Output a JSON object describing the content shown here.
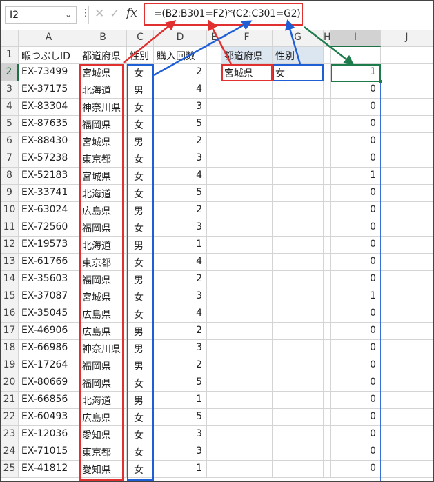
{
  "namebox": {
    "value": "I2",
    "dropdown_icon": "chevron-down-icon"
  },
  "formula_bar": {
    "more_icon": "ellipsis-icon",
    "cancel_icon": "close-icon",
    "enter_icon": "check-icon",
    "fx_label": "fx",
    "formula": "=(B2:B301=F2)*(C2:C301=G2)"
  },
  "columns": [
    "A",
    "B",
    "C",
    "D",
    "E",
    "F",
    "G",
    "H",
    "I",
    "J"
  ],
  "header_row": {
    "a": "暇つぶしID",
    "b": "都道府県",
    "c": "性別",
    "d": "購入回数",
    "f": "都道府県",
    "g": "性別"
  },
  "criteria": {
    "prefecture": "宮城県",
    "gender": "女"
  },
  "rows": [
    {
      "num": "2",
      "id": "EX-73499",
      "pref": "宮城県",
      "gender": "女",
      "count": "2",
      "result": "1"
    },
    {
      "num": "3",
      "id": "EX-37175",
      "pref": "北海道",
      "gender": "男",
      "count": "4",
      "result": "0"
    },
    {
      "num": "4",
      "id": "EX-83304",
      "pref": "神奈川県",
      "gender": "女",
      "count": "3",
      "result": "0"
    },
    {
      "num": "5",
      "id": "EX-87635",
      "pref": "福岡県",
      "gender": "女",
      "count": "5",
      "result": "0"
    },
    {
      "num": "6",
      "id": "EX-88430",
      "pref": "宮城県",
      "gender": "男",
      "count": "2",
      "result": "0"
    },
    {
      "num": "7",
      "id": "EX-57238",
      "pref": "東京都",
      "gender": "女",
      "count": "3",
      "result": "0"
    },
    {
      "num": "8",
      "id": "EX-52183",
      "pref": "宮城県",
      "gender": "女",
      "count": "4",
      "result": "1"
    },
    {
      "num": "9",
      "id": "EX-33741",
      "pref": "北海道",
      "gender": "女",
      "count": "5",
      "result": "0"
    },
    {
      "num": "10",
      "id": "EX-63024",
      "pref": "広島県",
      "gender": "男",
      "count": "2",
      "result": "0"
    },
    {
      "num": "11",
      "id": "EX-72560",
      "pref": "福岡県",
      "gender": "女",
      "count": "3",
      "result": "0"
    },
    {
      "num": "12",
      "id": "EX-19573",
      "pref": "北海道",
      "gender": "男",
      "count": "1",
      "result": "0"
    },
    {
      "num": "13",
      "id": "EX-61766",
      "pref": "東京都",
      "gender": "女",
      "count": "4",
      "result": "0"
    },
    {
      "num": "14",
      "id": "EX-35603",
      "pref": "福岡県",
      "gender": "男",
      "count": "2",
      "result": "0"
    },
    {
      "num": "15",
      "id": "EX-37087",
      "pref": "宮城県",
      "gender": "女",
      "count": "3",
      "result": "1"
    },
    {
      "num": "16",
      "id": "EX-35045",
      "pref": "広島県",
      "gender": "女",
      "count": "4",
      "result": "0"
    },
    {
      "num": "17",
      "id": "EX-46906",
      "pref": "広島県",
      "gender": "男",
      "count": "2",
      "result": "0"
    },
    {
      "num": "18",
      "id": "EX-66986",
      "pref": "神奈川県",
      "gender": "男",
      "count": "3",
      "result": "0"
    },
    {
      "num": "19",
      "id": "EX-17264",
      "pref": "福岡県",
      "gender": "男",
      "count": "2",
      "result": "0"
    },
    {
      "num": "20",
      "id": "EX-80669",
      "pref": "福岡県",
      "gender": "女",
      "count": "5",
      "result": "0"
    },
    {
      "num": "21",
      "id": "EX-66856",
      "pref": "北海道",
      "gender": "男",
      "count": "1",
      "result": "0"
    },
    {
      "num": "22",
      "id": "EX-60493",
      "pref": "広島県",
      "gender": "女",
      "count": "5",
      "result": "0"
    },
    {
      "num": "23",
      "id": "EX-12036",
      "pref": "愛知県",
      "gender": "女",
      "count": "3",
      "result": "0"
    },
    {
      "num": "24",
      "id": "EX-71015",
      "pref": "東京都",
      "gender": "女",
      "count": "3",
      "result": "0"
    },
    {
      "num": "25",
      "id": "EX-41812",
      "pref": "愛知県",
      "gender": "女",
      "count": "1",
      "result": "0"
    }
  ],
  "colors": {
    "red_box": "#e03030",
    "blue_box": "#1f5fd6",
    "green_box": "#1e7b4b",
    "header_bg": "#f2f2f2",
    "criteria_header_bg": "#dce6f1"
  }
}
